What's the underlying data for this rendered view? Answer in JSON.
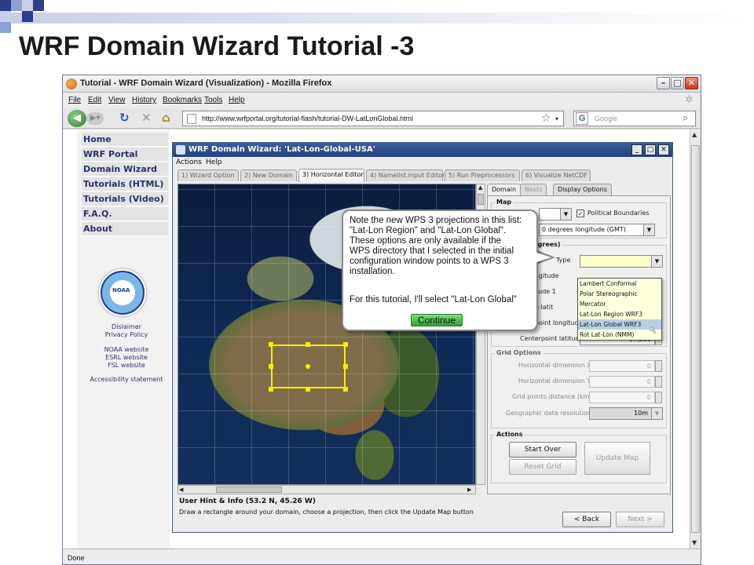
{
  "slide": {
    "title": "WRF Domain Wizard Tutorial -3"
  },
  "browser": {
    "title": "Tutorial - WRF Domain Wizard (Visualization) - Mozilla Firefox",
    "menu": [
      "File",
      "Edit",
      "View",
      "History",
      "Bookmarks",
      "Tools",
      "Help"
    ],
    "url": "http://www.wrfportal.org/tutorial-flash/tutorial-DW-LatLonGlobal.html",
    "search_placeholder": "Google",
    "status": "Done"
  },
  "sidebar": {
    "items": [
      "Home",
      "WRF Portal",
      "Domain Wizard",
      "Tutorials (HTML)",
      "Tutorials (Video)",
      "F.A.Q.",
      "About"
    ],
    "logo_text": "NOAA",
    "links": [
      "Dislaimer",
      "Privacy Policy",
      "NOAA website",
      "ESRL website",
      "FSL website",
      "Accessibility statement"
    ]
  },
  "app": {
    "title": "WRF Domain Wizard: 'Lat-Lon-Global-USA'",
    "menu": [
      "Actions",
      "Help"
    ],
    "tabs": [
      "1) Wizard Option",
      "2) New Domain",
      "3) Horizontal Editor",
      "4) Namelist.input Editor",
      "5) Run Preprocessors",
      "6) Visualize NetCDF"
    ],
    "active_tab": "3) Horizontal Editor",
    "panel_tabs": [
      "Domain",
      "Nests",
      "Display Options"
    ],
    "map_group": {
      "title": "Map",
      "political_boundaries": "Political Boundaries",
      "political_checked": true,
      "center_meridian": "0 degrees longitude (GMT)"
    },
    "options_group": {
      "title": "Options (degrees)",
      "type_label": "Type",
      "label_2": "d longitude",
      "label_3": "tude 1",
      "label_4": "ue latit",
      "centerpoint_longitude_label": "Centerpoint longitude",
      "centerpoint_latitude_label": "Centerpoint latitude",
      "centerpoint_latitude_value": "37,383"
    },
    "projection_options": [
      "Lambert Conformal",
      "Polar Stereographic",
      "Mercator",
      "Lat-Lon Region WRF3",
      "Lat-Lon Global WRF3",
      "Rot Lat-Lon (NMM)"
    ],
    "selected_projection": "Lat-Lon Global WRF3",
    "grid_group": {
      "title": "Grid Options",
      "fields": [
        {
          "label": "Horizontal dimension X",
          "value": "0"
        },
        {
          "label": "Horizontal dimension Y",
          "value": "0"
        },
        {
          "label": "Grid points distance (km)",
          "value": "0"
        },
        {
          "label": "Geographic data resolution",
          "value": "10m"
        }
      ]
    },
    "actions_group": {
      "title": "Actions",
      "start_over": "Start Over",
      "reset_grid": "Reset Grid",
      "update_map": "Update Map"
    },
    "hint": {
      "title": "User Hint & Info  (53.2 N, 45.26 W)",
      "text": "Draw a rectangle around your domain, choose a projection, then click the Update Map button"
    },
    "back": "< Back",
    "next": "Next >"
  },
  "callout": {
    "lines": [
      "Note the new WPS 3 projections in this list:",
      "\"Lat-Lon Region\" and \"Lat-Lon Global\".",
      "These options are only available if the",
      "WPS directory that I selected in the initial",
      "configuration window points to a WPS 3",
      "installation."
    ],
    "line2": "For this tutorial, I'll select \"Lat-Lon Global\"",
    "button": "Continue"
  },
  "colors": {
    "nav_text": "#27346b",
    "app_titlebar": "#23427c",
    "selection_box": "#ffec00",
    "continue_button": "#2ea12e"
  }
}
